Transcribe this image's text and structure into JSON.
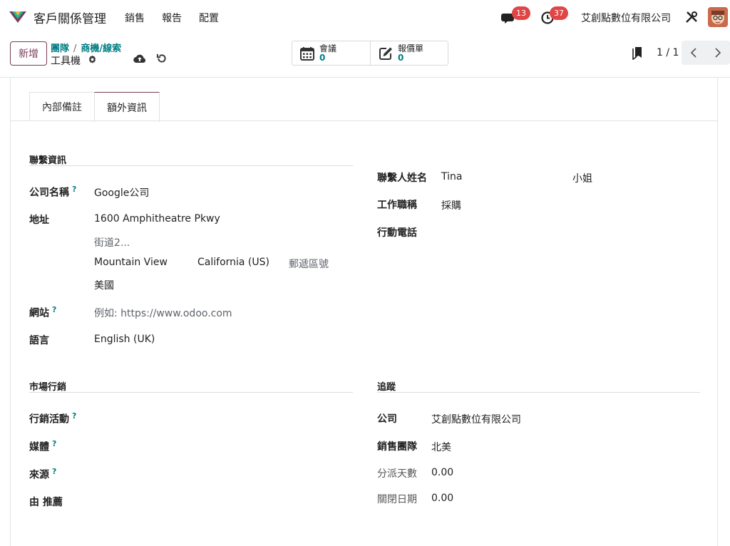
{
  "topbar": {
    "app_title": "客戶關係管理",
    "menu": [
      "銷售",
      "報告",
      "配置"
    ],
    "messages_count": "13",
    "activities_count": "37",
    "company": "艾創點數位有限公司",
    "icons": [
      "chat-icon",
      "clock-icon",
      "tools-icon"
    ]
  },
  "control": {
    "new_label": "新增",
    "breadcrumb": [
      "團隊",
      "商機/線索"
    ],
    "breadcrumb_sep": "/",
    "record_title": "工具機",
    "smart_buttons": [
      {
        "label": "會議",
        "count": "0",
        "icon": "calendar-icon"
      },
      {
        "label": "報價單",
        "count": "0",
        "icon": "edit-icon"
      }
    ],
    "pager": "1 / 1"
  },
  "tabs": [
    {
      "label": "內部備註",
      "active": false
    },
    {
      "label": "額外資訊",
      "active": true
    }
  ],
  "contact_info": {
    "title": "聯繫資訊",
    "company_label": "公司名稱",
    "company_value": "Google公司",
    "address_label": "地址",
    "street": "1600 Amphitheatre Pkwy",
    "street2_placeholder": "街道2...",
    "city": "Mountain View",
    "state": "California (US)",
    "zip_placeholder": "郵遞區號",
    "country": "美國",
    "website_label": "網站",
    "website_placeholder": "例如: https://www.odoo.com",
    "language_label": "語言",
    "language_value": "English (UK)"
  },
  "contact_person": {
    "name_label": "聯繫人姓名",
    "name_value": "Tina",
    "title_value": "小姐",
    "job_label": "工作職稱",
    "job_value": "採購",
    "mobile_label": "行動電話",
    "mobile_value": ""
  },
  "marketing": {
    "title": "市場行銷",
    "campaign_label": "行銷活動",
    "medium_label": "媒體",
    "source_label": "來源",
    "referred_label": "由 推薦"
  },
  "tracking": {
    "title": "追蹤",
    "company_label": "公司",
    "company_value": "艾創點數位有限公司",
    "team_label": "銷售團隊",
    "team_value": "北美",
    "days_assign_label": "分派天數",
    "days_assign_value": "0.00",
    "days_close_label": "關閉日期",
    "days_close_value": "0.00"
  },
  "colors": {
    "brand": "#7a3b59",
    "link": "#017e84",
    "badge": "#e04646"
  }
}
